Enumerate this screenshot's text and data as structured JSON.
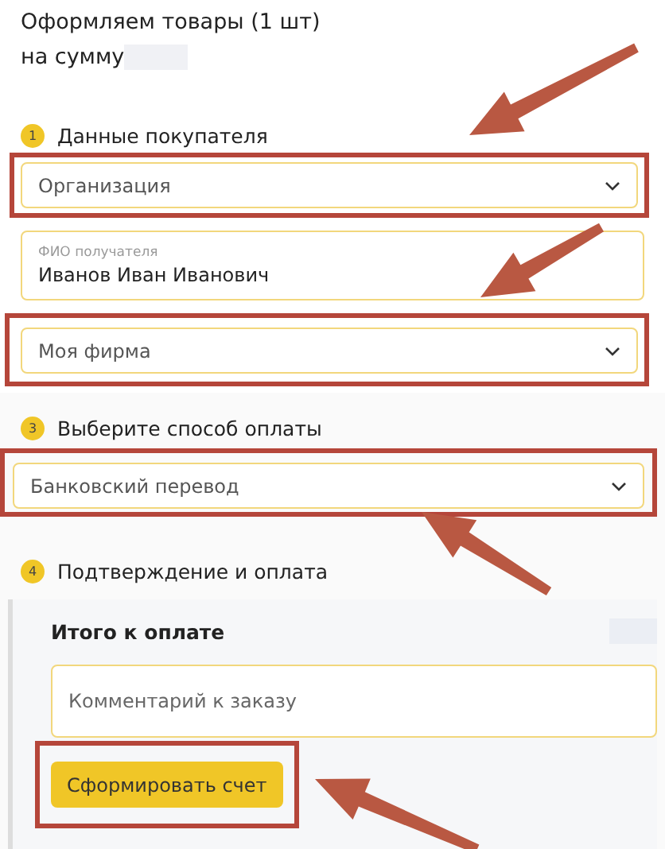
{
  "order_summary": {
    "line_1": "Оформляем товары (1 шт)",
    "line_2": "на сумму"
  },
  "steps": [
    {
      "number": "1",
      "title": "Данные покупателя",
      "fields": [
        {
          "kind": "select",
          "value": "Организация",
          "highlighted": true
        },
        {
          "kind": "text",
          "label": "ФИО получателя",
          "value": "Иванов Иван Иванович",
          "highlighted": false
        },
        {
          "kind": "select",
          "value": "Моя фирма",
          "highlighted": true
        }
      ]
    },
    {
      "number": "3",
      "title": "Выберите способ оплаты",
      "fields": [
        {
          "kind": "select",
          "value": "Банковский перевод",
          "highlighted": true
        }
      ]
    },
    {
      "number": "4",
      "title": "Подтверждение и оплата"
    }
  ],
  "summary_panel": {
    "total_label": "Итого к оплате",
    "comment": {
      "placeholder": "Комментарий к заказу"
    },
    "submit_button": {
      "label": "Сформировать счет",
      "highlighted": true
    }
  }
}
